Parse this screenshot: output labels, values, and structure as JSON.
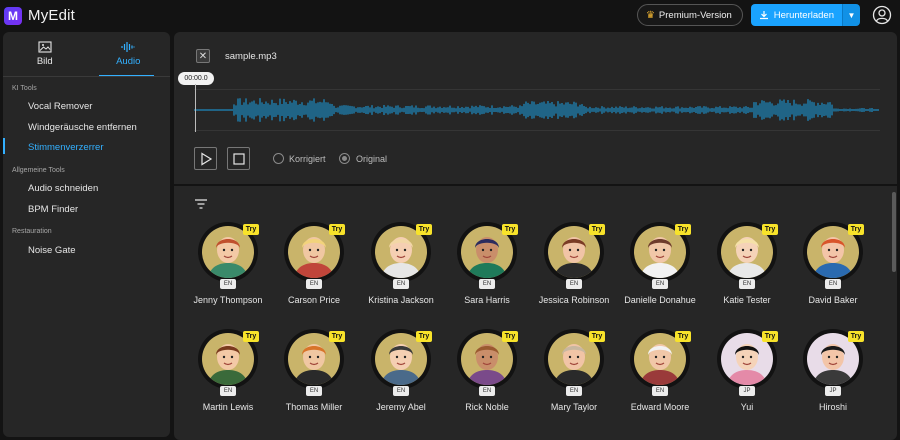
{
  "app": {
    "logo_letter": "M",
    "name": "MyEdit"
  },
  "header": {
    "premium_label": "Premium-Version",
    "download_label": "Herunterladen"
  },
  "sidebar": {
    "tabs": [
      {
        "label": "Bild",
        "icon": "image-icon"
      },
      {
        "label": "Audio",
        "icon": "audio-waves-icon",
        "active": true
      }
    ],
    "sections": [
      {
        "title": "KI Tools",
        "items": [
          "Vocal Remover",
          "Windgeräusche entfernen",
          "Stimmenverzerrer"
        ]
      },
      {
        "title": "Allgemeine Tools",
        "items": [
          "Audio schneiden",
          "BPM Finder"
        ]
      },
      {
        "title": "Restauration",
        "items": [
          "Noise Gate"
        ]
      }
    ],
    "active_item": "Stimmenverzerrer"
  },
  "player": {
    "file_name": "sample.mp3",
    "time": "00:00.0",
    "options": [
      {
        "label": "Korrigiert",
        "checked": false
      },
      {
        "label": "Original",
        "checked": true
      }
    ],
    "waveform_color": "#1aa3e6"
  },
  "voices": {
    "try_label": "Try",
    "rows": [
      [
        {
          "name": "Jenny Thompson",
          "lang": "EN"
        },
        {
          "name": "Carson Price",
          "lang": "EN"
        },
        {
          "name": "Kristina Jackson",
          "lang": "EN"
        },
        {
          "name": "Sara Harris",
          "lang": "EN"
        },
        {
          "name": "Jessica Robinson",
          "lang": "EN"
        },
        {
          "name": "Danielle Donahue",
          "lang": "EN"
        },
        {
          "name": "Katie Tester",
          "lang": "EN"
        },
        {
          "name": "David Baker",
          "lang": "EN"
        }
      ],
      [
        {
          "name": "Martin Lewis",
          "lang": "EN"
        },
        {
          "name": "Thomas Miller",
          "lang": "EN"
        },
        {
          "name": "Jeremy Abel",
          "lang": "EN"
        },
        {
          "name": "Rick Noble",
          "lang": "EN"
        },
        {
          "name": "Mary Taylor",
          "lang": "EN"
        },
        {
          "name": "Edward Moore",
          "lang": "EN"
        },
        {
          "name": "Yui",
          "lang": "JP"
        },
        {
          "name": "Hiroshi",
          "lang": "JP"
        }
      ]
    ]
  },
  "colors": {
    "accent": "#33b0ff",
    "panel": "#262626",
    "background": "#131313",
    "try_badge": "#f8e32a"
  }
}
